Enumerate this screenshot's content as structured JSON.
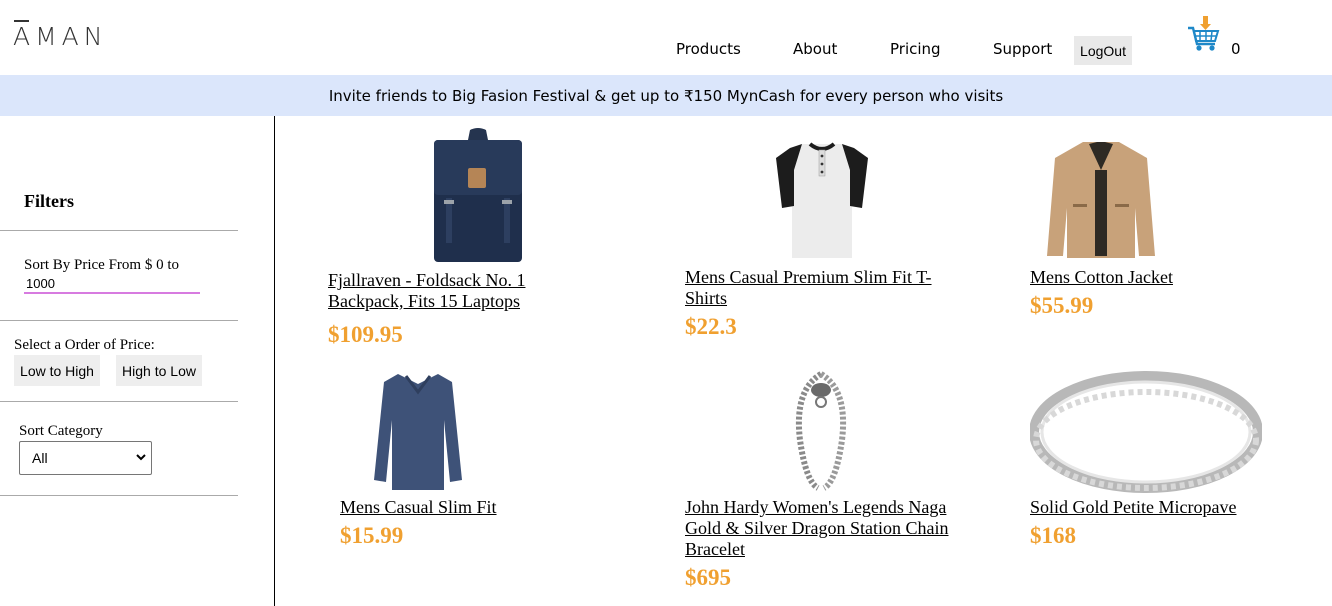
{
  "header": {
    "logo": "AMAN",
    "nav": [
      "Products",
      "About",
      "Pricing",
      "Support"
    ],
    "logout_label": "LogOut",
    "cart_count": "0"
  },
  "banner": {
    "text": "Invite friends to Big Fasion Festival & get up to ₹150 MynCash for every person who visits"
  },
  "sidebar": {
    "title": "Filters",
    "price_label": "Sort By Price From $ 0 to",
    "price_value": "1000",
    "order_label": "Select a Order of Price:",
    "low_high": "Low to High",
    "high_low": "High to Low",
    "category_label": "Sort Category",
    "category_value": "All"
  },
  "products": [
    {
      "title": "Fjallraven - Foldsack No. 1 Backpack, Fits 15 Laptops",
      "price": "$109.95",
      "image": "backpack-image"
    },
    {
      "title": "Mens Casual Premium Slim Fit T-Shirts",
      "price": "$22.3",
      "image": "tshirt-image"
    },
    {
      "title": "Mens Cotton Jacket",
      "price": "$55.99",
      "image": "jacket-image"
    },
    {
      "title": "Mens Casual Slim Fit",
      "price": "$15.99",
      "image": "longsleeve-image"
    },
    {
      "title": "John Hardy Women's Legends Naga Gold & Silver Dragon Station Chain Bracelet",
      "price": "$695",
      "image": "bracelet-image"
    },
    {
      "title": "Solid Gold Petite Micropave",
      "price": "$168",
      "image": "ring-image"
    }
  ],
  "colors": {
    "banner_bg": "#dbe6fb",
    "price": "#f0a030",
    "accent_underline": "#d77be0"
  }
}
